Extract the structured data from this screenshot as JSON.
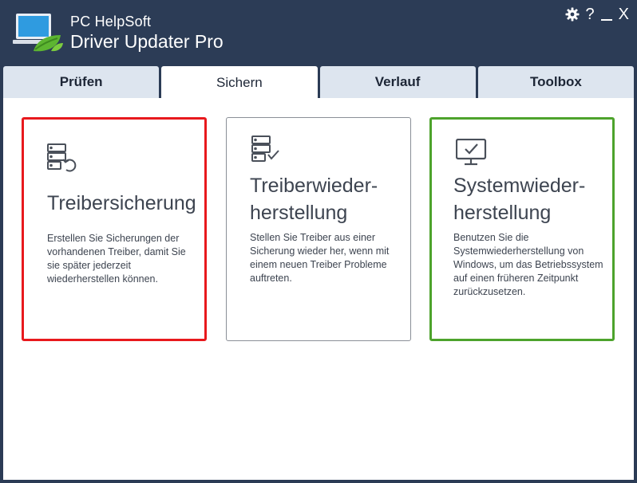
{
  "app": {
    "brand_line1": "PC HelpSoft",
    "brand_line2": "Driver Updater Pro"
  },
  "window_controls": {
    "help": "?",
    "close": "X"
  },
  "tabs": [
    {
      "label": "Prüfen",
      "active": false
    },
    {
      "label": "Sichern",
      "active": true
    },
    {
      "label": "Verlauf",
      "active": false
    },
    {
      "label": "Toolbox",
      "active": false
    }
  ],
  "cards": [
    {
      "title": "Treibersicherung",
      "description": "Erstellen Sie Sicherungen der vorhandenen Treiber, damit Sie sie später jederzeit wiederherstellen können.",
      "icon": "server-backup-icon",
      "border_color": "#e8191d"
    },
    {
      "title_line1": "Treiberwieder-",
      "title_line2": "herstellung",
      "description": "Stellen Sie Treiber aus einer Sicherung wieder her, wenn mit einem neuen Treiber Probleme auftreten.",
      "icon": "server-check-icon",
      "border_color": "#8a8f97"
    },
    {
      "title_line1": "Systemwieder-",
      "title_line2": "herstellung",
      "description": "Benutzen Sie die Systemwiederherstellung von Windows, um das Betriebssystem auf einen früheren Zeitpunkt zurückzusetzen.",
      "icon": "monitor-check-icon",
      "border_color": "#4da32c"
    }
  ],
  "colors": {
    "titlebar": "#2c3c56",
    "tab_inactive": "#dde5ef",
    "accent_red": "#e8191d",
    "accent_green": "#4da32c"
  }
}
